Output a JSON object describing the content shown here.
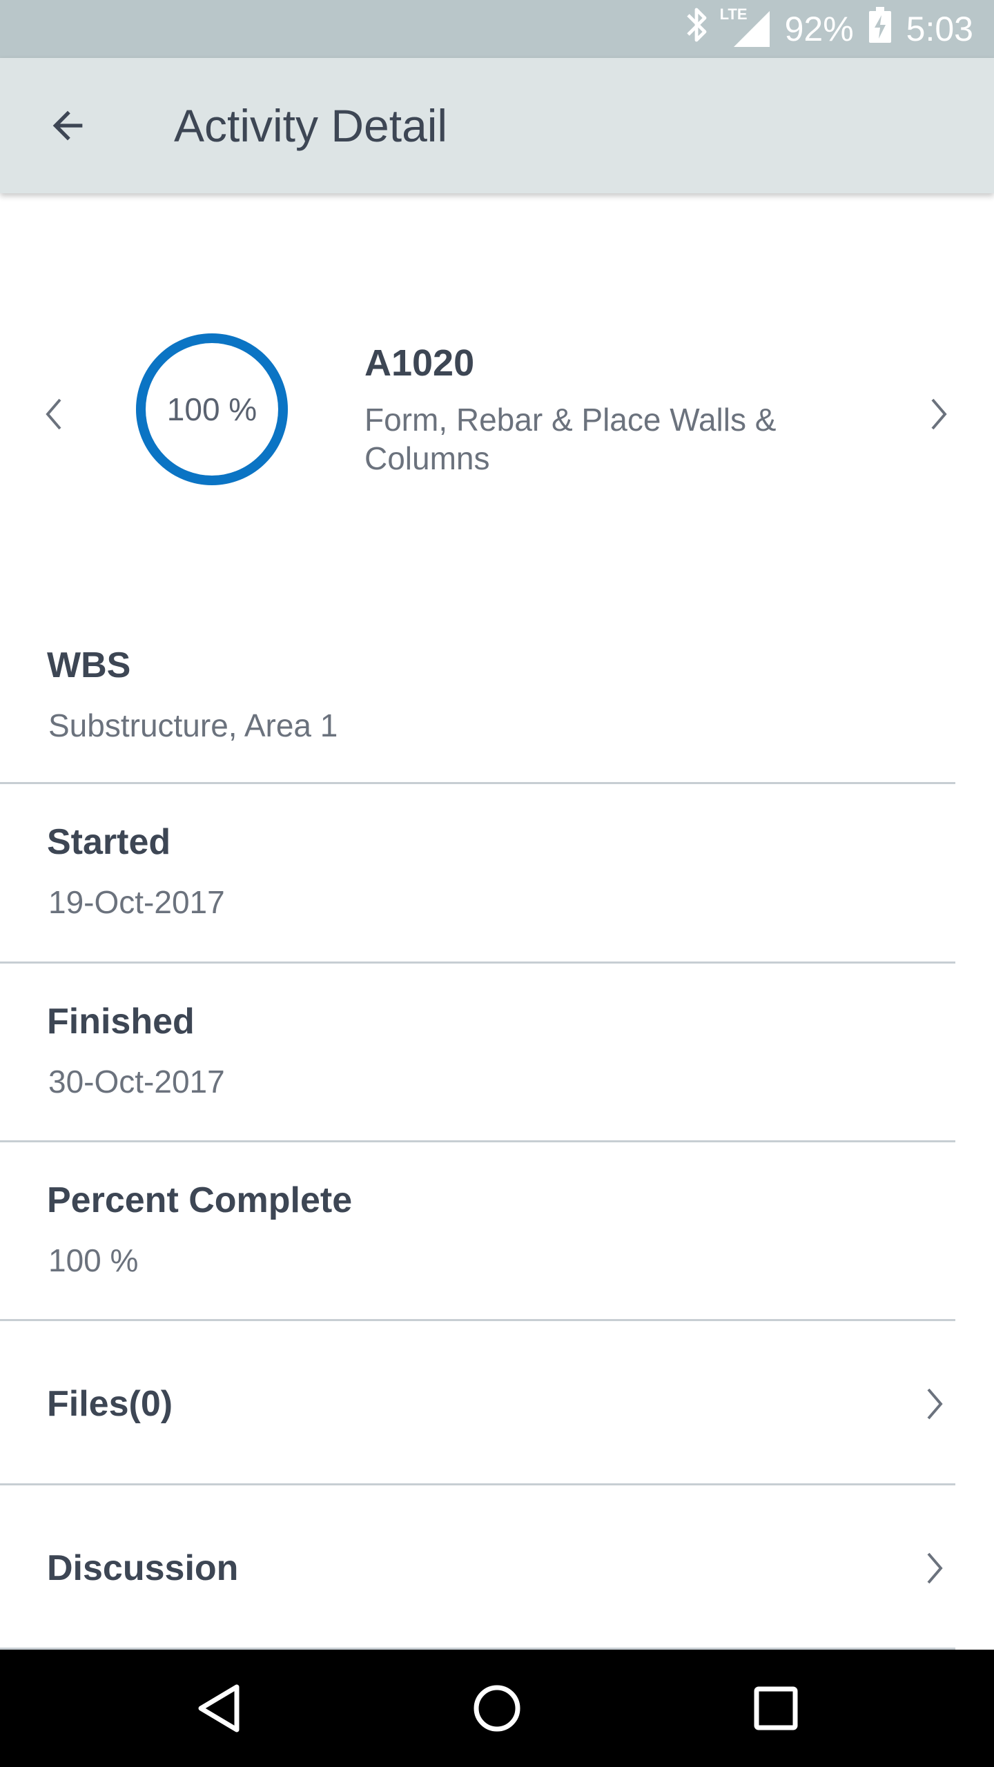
{
  "status_bar": {
    "network": "LTE",
    "battery": "92%",
    "time": "5:03"
  },
  "app_bar": {
    "title": "Activity Detail"
  },
  "activity": {
    "percent_label": "100 %",
    "percent_value": 100,
    "code": "A1020",
    "name": "Form, Rebar & Place Walls & Columns"
  },
  "details": {
    "wbs": {
      "label": "WBS",
      "value": "Substructure, Area 1"
    },
    "started": {
      "label": "Started",
      "value": "19-Oct-2017"
    },
    "finished": {
      "label": "Finished",
      "value": "30-Oct-2017"
    },
    "percent_complete": {
      "label": "Percent Complete",
      "value": "100 %"
    },
    "files": {
      "label": "Files(0)"
    },
    "discussion": {
      "label": "Discussion"
    }
  },
  "colors": {
    "progress_ring": "#0b74c4",
    "app_bar": "#dde4e5",
    "status_bar": "#b9c6c9"
  }
}
